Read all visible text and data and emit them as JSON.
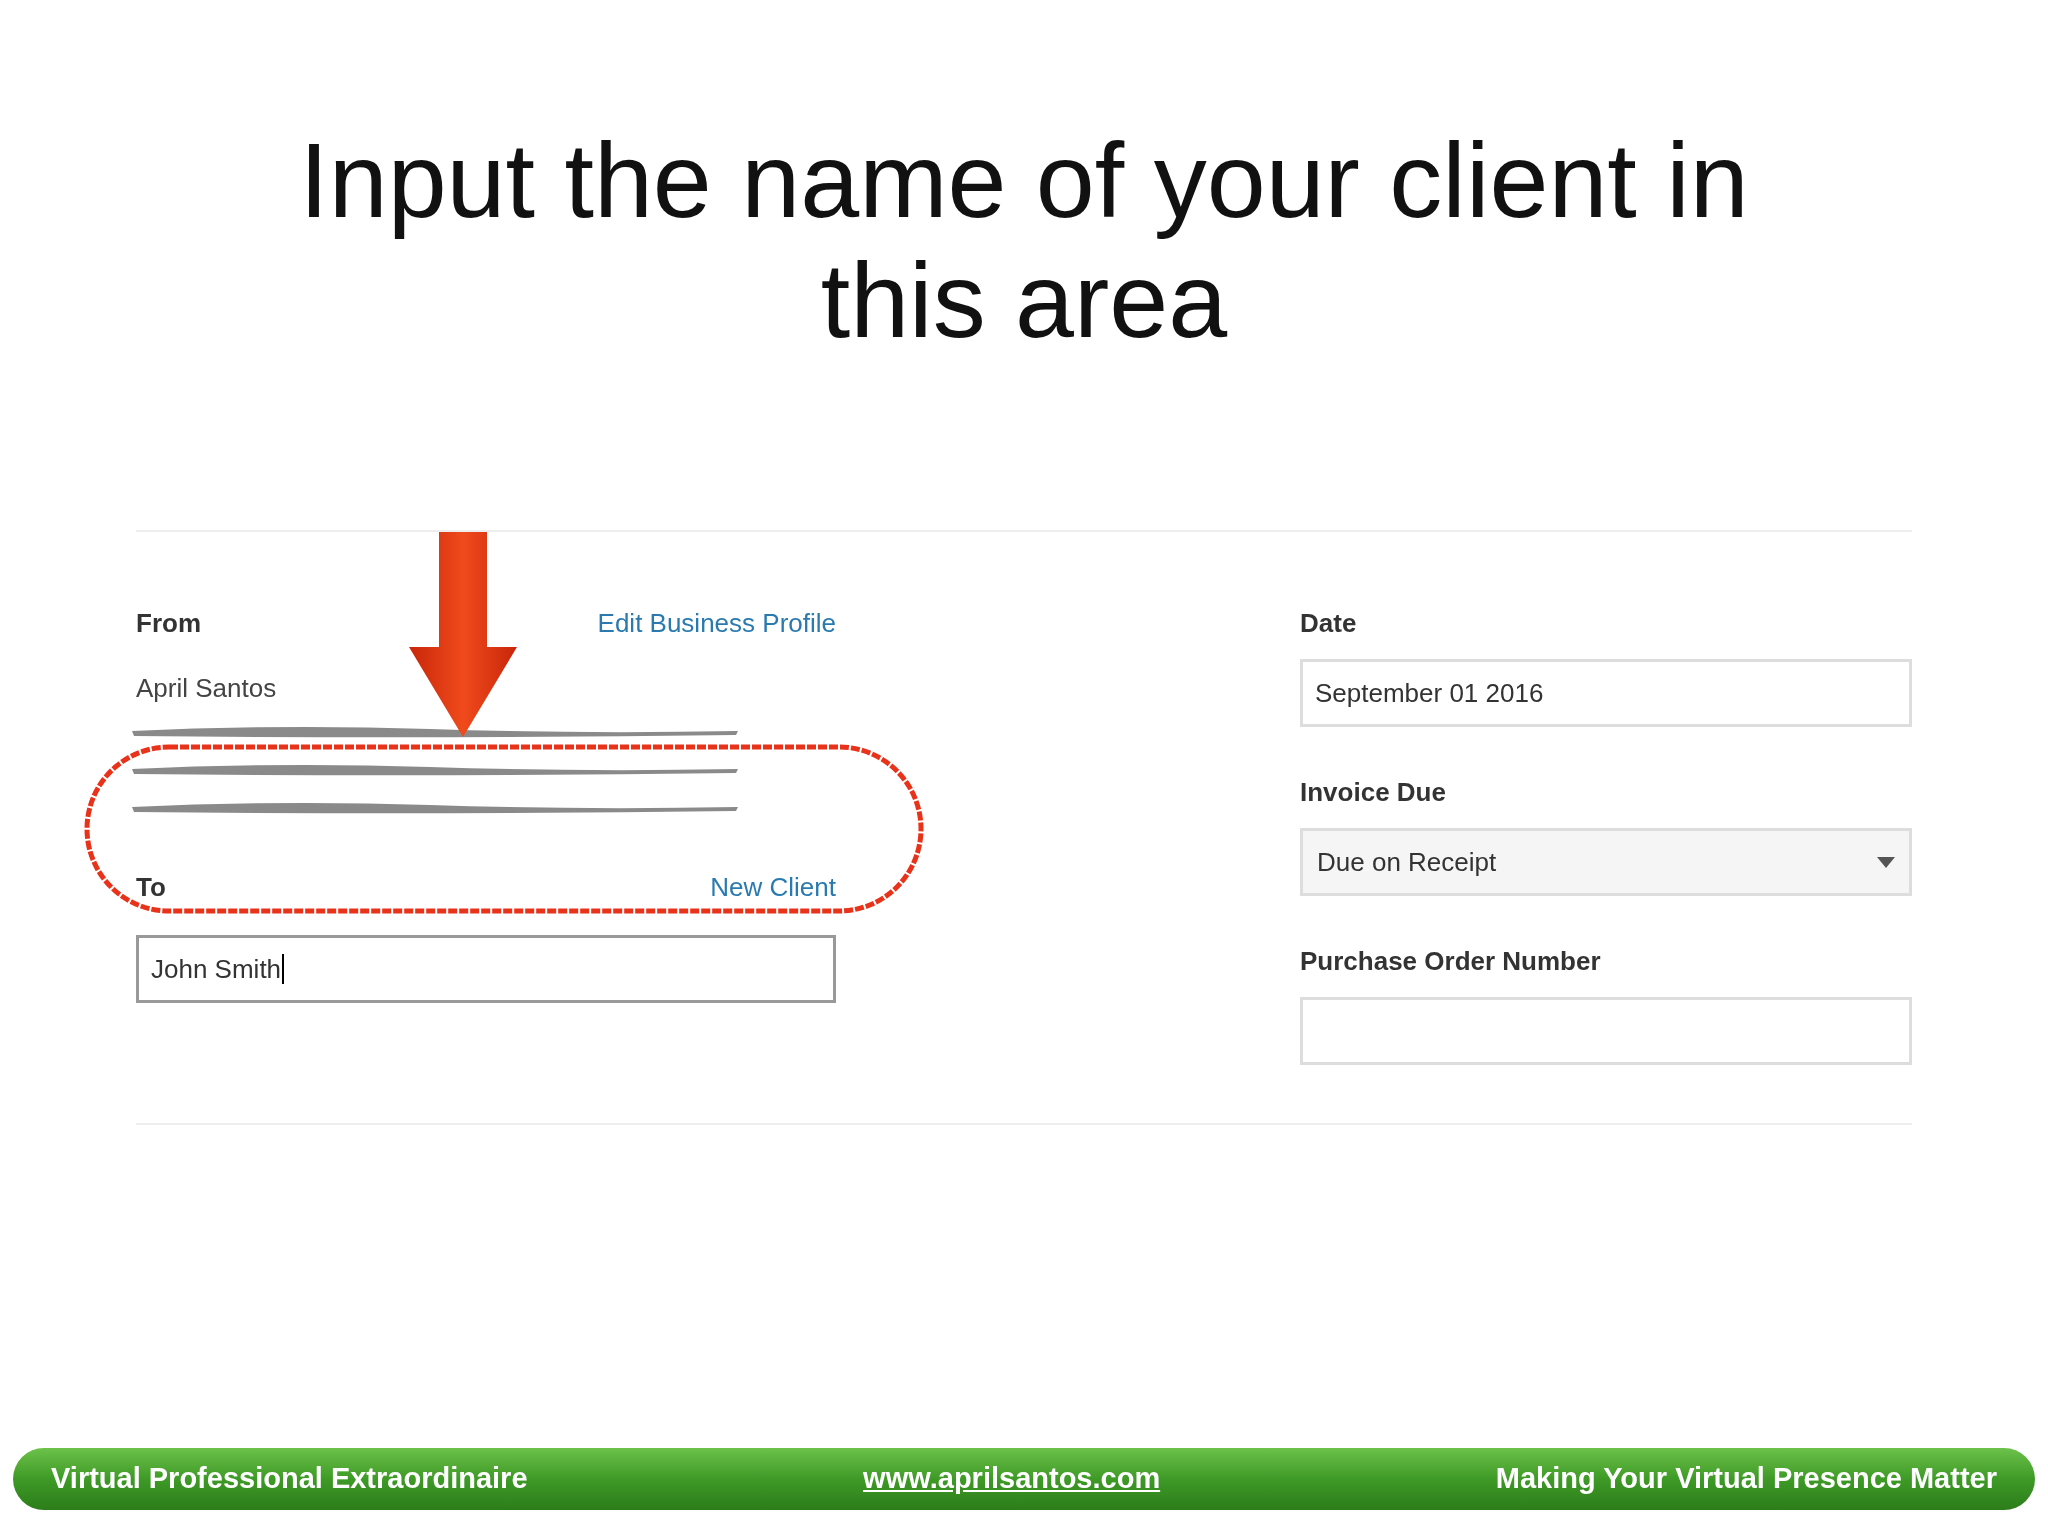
{
  "slide": {
    "title": "Input the name of your client in this area"
  },
  "from": {
    "label": "From",
    "link": "Edit Business Profile",
    "name": "April Santos",
    "address_lines": [
      {
        "kind": "redacted"
      },
      {
        "kind": "redacted"
      },
      {
        "kind": "redacted"
      }
    ]
  },
  "to": {
    "label": "To",
    "link": "New Client",
    "value": "John Smith"
  },
  "date": {
    "label": "Date",
    "value": "September 01 2016"
  },
  "invoice_due": {
    "label": "Invoice Due",
    "value": "Due on Receipt"
  },
  "purchase_order": {
    "label": "Purchase Order Number"
  },
  "footer": {
    "left": "Virtual Professional Extraordinaire",
    "center": "www.aprilsantos.com",
    "right": "Making Your Virtual Presence Matter"
  }
}
